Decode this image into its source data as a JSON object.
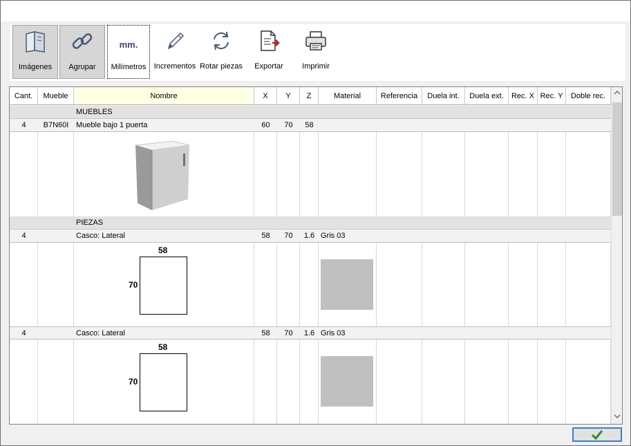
{
  "toolbar": {
    "buttons": [
      {
        "label": "Imágenes",
        "icon": "book-icon",
        "state": "pressed"
      },
      {
        "label": "Agrupar",
        "icon": "chain-link-icon",
        "state": "pressed"
      },
      {
        "label": "Milímetros",
        "icon": "mm-text-icon",
        "icon_text": "mm.",
        "state": "focused"
      },
      {
        "label": "Incrementos",
        "icon": "pencil-icon",
        "state": "normal"
      },
      {
        "label": "Rotar piezas",
        "icon": "rotate-arrows-icon",
        "state": "normal"
      },
      {
        "label": "Exportar",
        "icon": "export-document-icon",
        "state": "normal"
      },
      {
        "label": "Imprimir",
        "icon": "printer-icon",
        "state": "normal"
      }
    ]
  },
  "table": {
    "columns": [
      "Cant.",
      "Mueble",
      "Nombre",
      "X",
      "Y",
      "Z",
      "Material",
      "Referencia",
      "Duela int.",
      "Duela ext.",
      "Rec. X",
      "Rec. Y",
      "Doble rec."
    ],
    "groups": [
      {
        "title": "MUEBLES",
        "rows": [
          {
            "cant": "4",
            "mueble": "B7N60I",
            "nombre": "Mueble bajo 1 puerta",
            "x": "60",
            "y": "70",
            "z": "58",
            "material": "",
            "image": "cabinet-3d"
          }
        ]
      },
      {
        "title": "PIEZAS",
        "rows": [
          {
            "cant": "4",
            "mueble": "",
            "nombre": "Casco: Lateral",
            "x": "58",
            "y": "70",
            "z": "1.6",
            "material": "Gris 03",
            "piece_width": "58",
            "piece_height": "70",
            "swatch_color": "#c0c0c0"
          },
          {
            "cant": "4",
            "mueble": "",
            "nombre": "Casco: Lateral",
            "x": "58",
            "y": "70",
            "z": "1.6",
            "material": "Gris 03",
            "piece_width": "58",
            "piece_height": "70",
            "swatch_color": "#c0c0c0"
          }
        ]
      }
    ]
  },
  "footer": {
    "ok_icon": "checkmark-icon",
    "ok_color": "#2e8b2e"
  },
  "colors": {
    "nombre_header": "#ffffe4",
    "group_row": "#e2e2e2",
    "data_row": "#f2f2f2",
    "focus_border": "#3b7fc4"
  }
}
